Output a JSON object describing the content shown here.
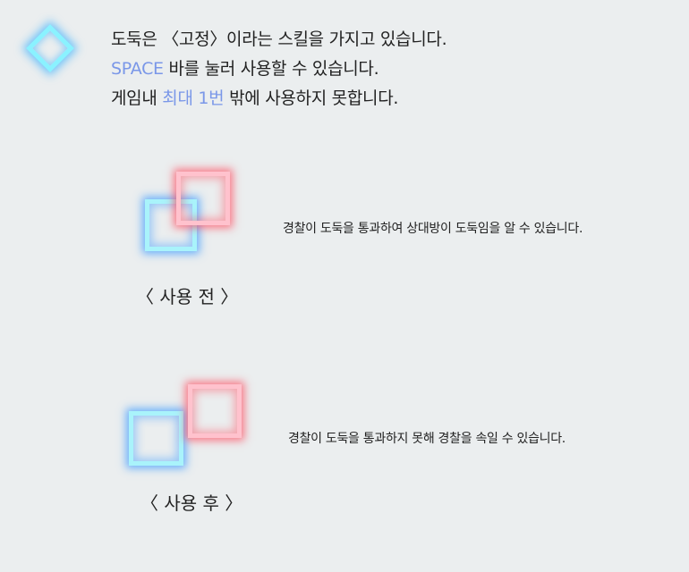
{
  "colors": {
    "background": "#ebeeef",
    "accent": "#7a97e8",
    "text": "#222222",
    "glow_blue": "#a9f3fb",
    "glow_pink": "#ffc2cd"
  },
  "icon": "diamond-glow-icon",
  "intro": {
    "line1": "도둑은 〈고정〉이라는 스킬을 가지고 있습니다.",
    "line2_accent": "SPACE",
    "line2_rest": " 바를 눌러 사용할 수 있습니다.",
    "line3_prefix": "게임내 ",
    "line3_accent": "최대 1번",
    "line3_suffix": " 밖에 사용하지 못합니다."
  },
  "before": {
    "caption": "〈 사용 전 〉",
    "description": "경찰이 도둑을 통과하여 상대방이 도둑임을 알 수 있습니다."
  },
  "after": {
    "caption": "〈 사용 후 〉",
    "description": "경찰이 도둑을 통과하지 못해 경찰을 속일 수 있습니다."
  }
}
